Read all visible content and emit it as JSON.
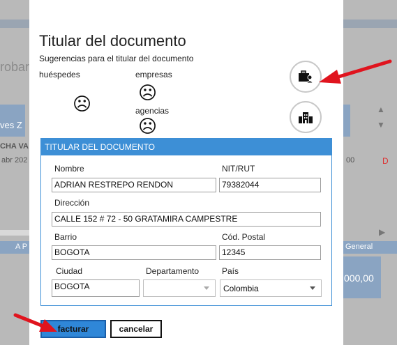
{
  "background": {
    "partial_texts": [
      "robar",
      "ves Z",
      "CHA VA",
      "abr 202",
      "A P",
      "00",
      "D",
      "General",
      "000,00"
    ]
  },
  "dialog": {
    "title": "Titular del documento",
    "subtitle": "Sugerencias para el titular del documento",
    "suggestions": {
      "guests_label": "huéspedes",
      "companies_label": "empresas",
      "agencies_label": "agencias",
      "empty_glyph": "☹"
    },
    "buttons_side": {
      "company_icon": "briefcase-person-icon",
      "agency_icon": "buildings-icon"
    },
    "panel": {
      "header": "TITULAR DEL DOCUMENTO",
      "fields": {
        "nombre_label": "Nombre",
        "nombre_value": "ADRIAN RESTREPO RENDON",
        "nit_label": "NIT/RUT",
        "nit_value": "79382044",
        "direccion_label": "Dirección",
        "direccion_value": "CALLE 152 # 72 - 50 GRATAMIRA CAMPESTRE",
        "barrio_label": "Barrio",
        "barrio_value": "BOGOTA",
        "postal_label": "Cód. Postal",
        "postal_value": "12345",
        "ciudad_label": "Ciudad",
        "ciudad_value": "BOGOTA",
        "departamento_label": "Departamento",
        "departamento_value": "",
        "pais_label": "País",
        "pais_value": "Colombia"
      }
    },
    "actions": {
      "submit_label": "facturar",
      "cancel_label": "cancelar"
    }
  },
  "colors": {
    "accent": "#3d8fd6",
    "arrow": "#e0141e"
  }
}
